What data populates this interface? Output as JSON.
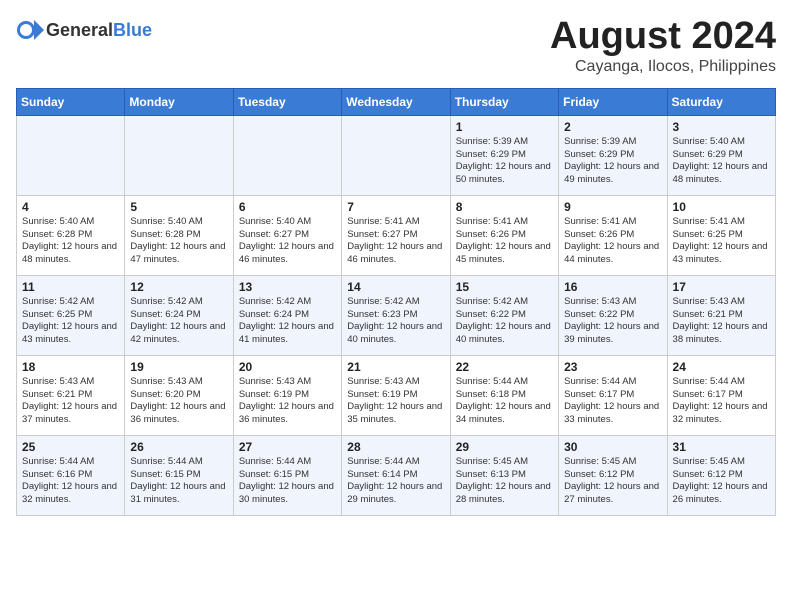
{
  "header": {
    "logo_general": "General",
    "logo_blue": "Blue",
    "month_title": "August 2024",
    "location": "Cayanga, Ilocos, Philippines"
  },
  "weekdays": [
    "Sunday",
    "Monday",
    "Tuesday",
    "Wednesday",
    "Thursday",
    "Friday",
    "Saturday"
  ],
  "weeks": [
    [
      {
        "day": "",
        "info": ""
      },
      {
        "day": "",
        "info": ""
      },
      {
        "day": "",
        "info": ""
      },
      {
        "day": "",
        "info": ""
      },
      {
        "day": "1",
        "info": "Sunrise: 5:39 AM\nSunset: 6:29 PM\nDaylight: 12 hours and 50 minutes."
      },
      {
        "day": "2",
        "info": "Sunrise: 5:39 AM\nSunset: 6:29 PM\nDaylight: 12 hours and 49 minutes."
      },
      {
        "day": "3",
        "info": "Sunrise: 5:40 AM\nSunset: 6:29 PM\nDaylight: 12 hours and 48 minutes."
      }
    ],
    [
      {
        "day": "4",
        "info": "Sunrise: 5:40 AM\nSunset: 6:28 PM\nDaylight: 12 hours and 48 minutes."
      },
      {
        "day": "5",
        "info": "Sunrise: 5:40 AM\nSunset: 6:28 PM\nDaylight: 12 hours and 47 minutes."
      },
      {
        "day": "6",
        "info": "Sunrise: 5:40 AM\nSunset: 6:27 PM\nDaylight: 12 hours and 46 minutes."
      },
      {
        "day": "7",
        "info": "Sunrise: 5:41 AM\nSunset: 6:27 PM\nDaylight: 12 hours and 46 minutes."
      },
      {
        "day": "8",
        "info": "Sunrise: 5:41 AM\nSunset: 6:26 PM\nDaylight: 12 hours and 45 minutes."
      },
      {
        "day": "9",
        "info": "Sunrise: 5:41 AM\nSunset: 6:26 PM\nDaylight: 12 hours and 44 minutes."
      },
      {
        "day": "10",
        "info": "Sunrise: 5:41 AM\nSunset: 6:25 PM\nDaylight: 12 hours and 43 minutes."
      }
    ],
    [
      {
        "day": "11",
        "info": "Sunrise: 5:42 AM\nSunset: 6:25 PM\nDaylight: 12 hours and 43 minutes."
      },
      {
        "day": "12",
        "info": "Sunrise: 5:42 AM\nSunset: 6:24 PM\nDaylight: 12 hours and 42 minutes."
      },
      {
        "day": "13",
        "info": "Sunrise: 5:42 AM\nSunset: 6:24 PM\nDaylight: 12 hours and 41 minutes."
      },
      {
        "day": "14",
        "info": "Sunrise: 5:42 AM\nSunset: 6:23 PM\nDaylight: 12 hours and 40 minutes."
      },
      {
        "day": "15",
        "info": "Sunrise: 5:42 AM\nSunset: 6:22 PM\nDaylight: 12 hours and 40 minutes."
      },
      {
        "day": "16",
        "info": "Sunrise: 5:43 AM\nSunset: 6:22 PM\nDaylight: 12 hours and 39 minutes."
      },
      {
        "day": "17",
        "info": "Sunrise: 5:43 AM\nSunset: 6:21 PM\nDaylight: 12 hours and 38 minutes."
      }
    ],
    [
      {
        "day": "18",
        "info": "Sunrise: 5:43 AM\nSunset: 6:21 PM\nDaylight: 12 hours and 37 minutes."
      },
      {
        "day": "19",
        "info": "Sunrise: 5:43 AM\nSunset: 6:20 PM\nDaylight: 12 hours and 36 minutes."
      },
      {
        "day": "20",
        "info": "Sunrise: 5:43 AM\nSunset: 6:19 PM\nDaylight: 12 hours and 36 minutes."
      },
      {
        "day": "21",
        "info": "Sunrise: 5:43 AM\nSunset: 6:19 PM\nDaylight: 12 hours and 35 minutes."
      },
      {
        "day": "22",
        "info": "Sunrise: 5:44 AM\nSunset: 6:18 PM\nDaylight: 12 hours and 34 minutes."
      },
      {
        "day": "23",
        "info": "Sunrise: 5:44 AM\nSunset: 6:17 PM\nDaylight: 12 hours and 33 minutes."
      },
      {
        "day": "24",
        "info": "Sunrise: 5:44 AM\nSunset: 6:17 PM\nDaylight: 12 hours and 32 minutes."
      }
    ],
    [
      {
        "day": "25",
        "info": "Sunrise: 5:44 AM\nSunset: 6:16 PM\nDaylight: 12 hours and 32 minutes."
      },
      {
        "day": "26",
        "info": "Sunrise: 5:44 AM\nSunset: 6:15 PM\nDaylight: 12 hours and 31 minutes."
      },
      {
        "day": "27",
        "info": "Sunrise: 5:44 AM\nSunset: 6:15 PM\nDaylight: 12 hours and 30 minutes."
      },
      {
        "day": "28",
        "info": "Sunrise: 5:44 AM\nSunset: 6:14 PM\nDaylight: 12 hours and 29 minutes."
      },
      {
        "day": "29",
        "info": "Sunrise: 5:45 AM\nSunset: 6:13 PM\nDaylight: 12 hours and 28 minutes."
      },
      {
        "day": "30",
        "info": "Sunrise: 5:45 AM\nSunset: 6:12 PM\nDaylight: 12 hours and 27 minutes."
      },
      {
        "day": "31",
        "info": "Sunrise: 5:45 AM\nSunset: 6:12 PM\nDaylight: 12 hours and 26 minutes."
      }
    ]
  ]
}
